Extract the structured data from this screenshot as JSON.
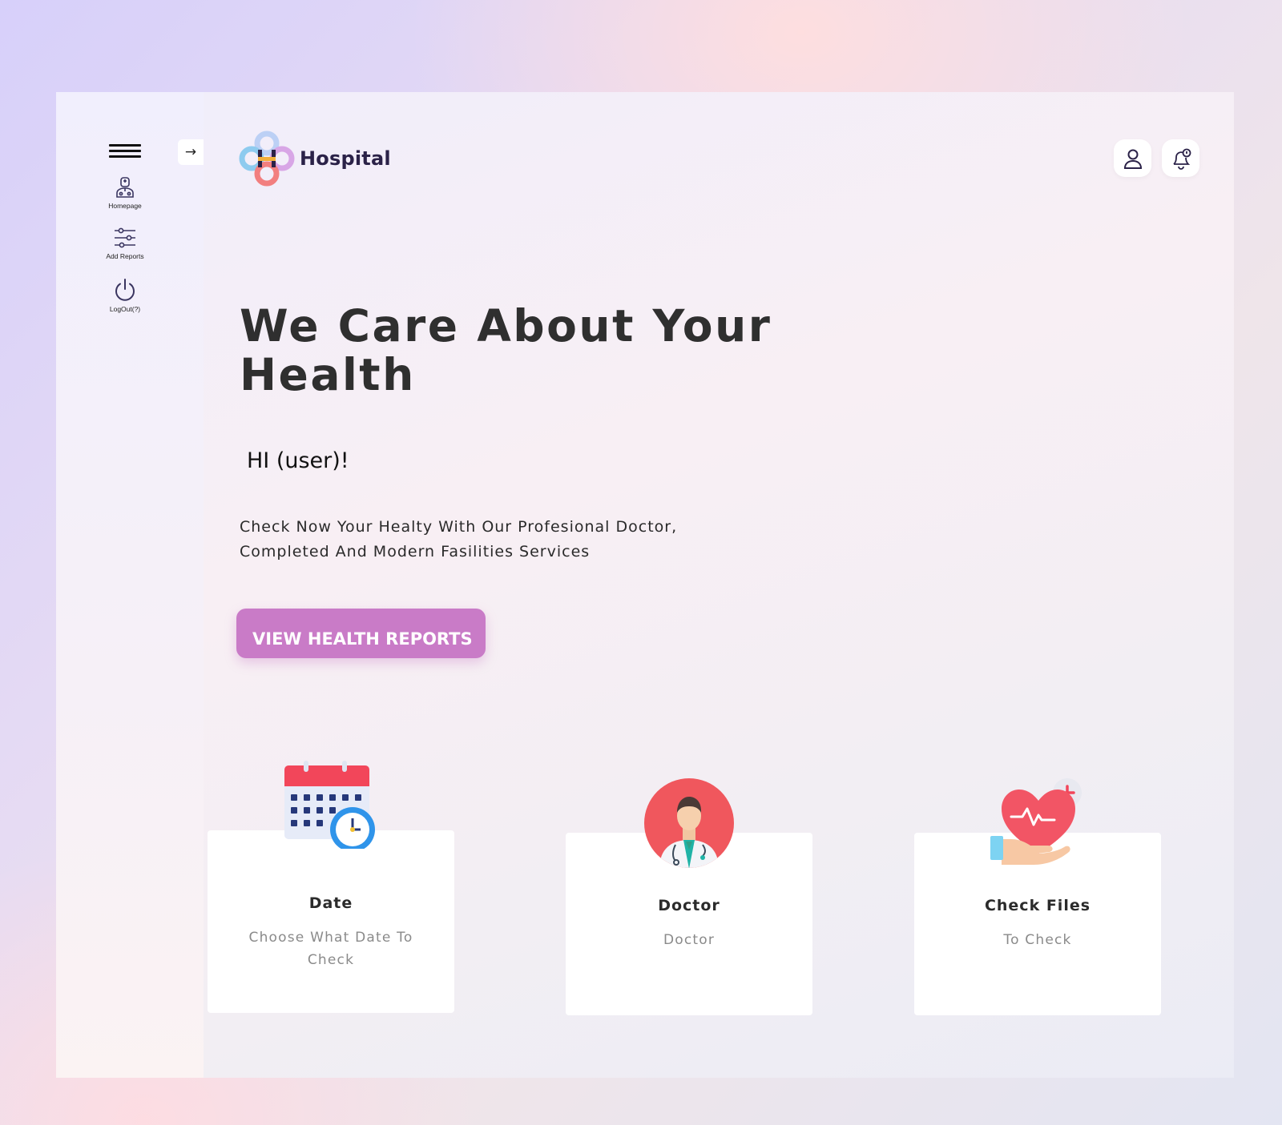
{
  "app": {
    "logo_text": "Hospital"
  },
  "sidebar": {
    "items": [
      {
        "label": "Homepage",
        "icon": "doctor-icon"
      },
      {
        "label": "Add Reports",
        "icon": "sliders-icon"
      },
      {
        "label": "LogOut(?)",
        "icon": "power-icon"
      }
    ]
  },
  "hero": {
    "title": "We Care About Your Health",
    "greeting": "HI (user)!",
    "subtitle": "Check Now Your Healty With Our Profesional Doctor, Completed And Modern Fasilities Services",
    "cta_label": "VIEW HEALTH REPORTS"
  },
  "cards": [
    {
      "title": "Date",
      "description": "Choose What Date To Check",
      "icon": "calendar-clock-icon"
    },
    {
      "title": "Doctor",
      "description": "Doctor",
      "icon": "doctor-avatar-icon"
    },
    {
      "title": "Check Files",
      "description": "To Check",
      "icon": "heart-hand-icon"
    }
  ],
  "colors": {
    "accent": "#c97bc7",
    "title": "#2f2f2f",
    "logo_text": "#2b2248"
  }
}
